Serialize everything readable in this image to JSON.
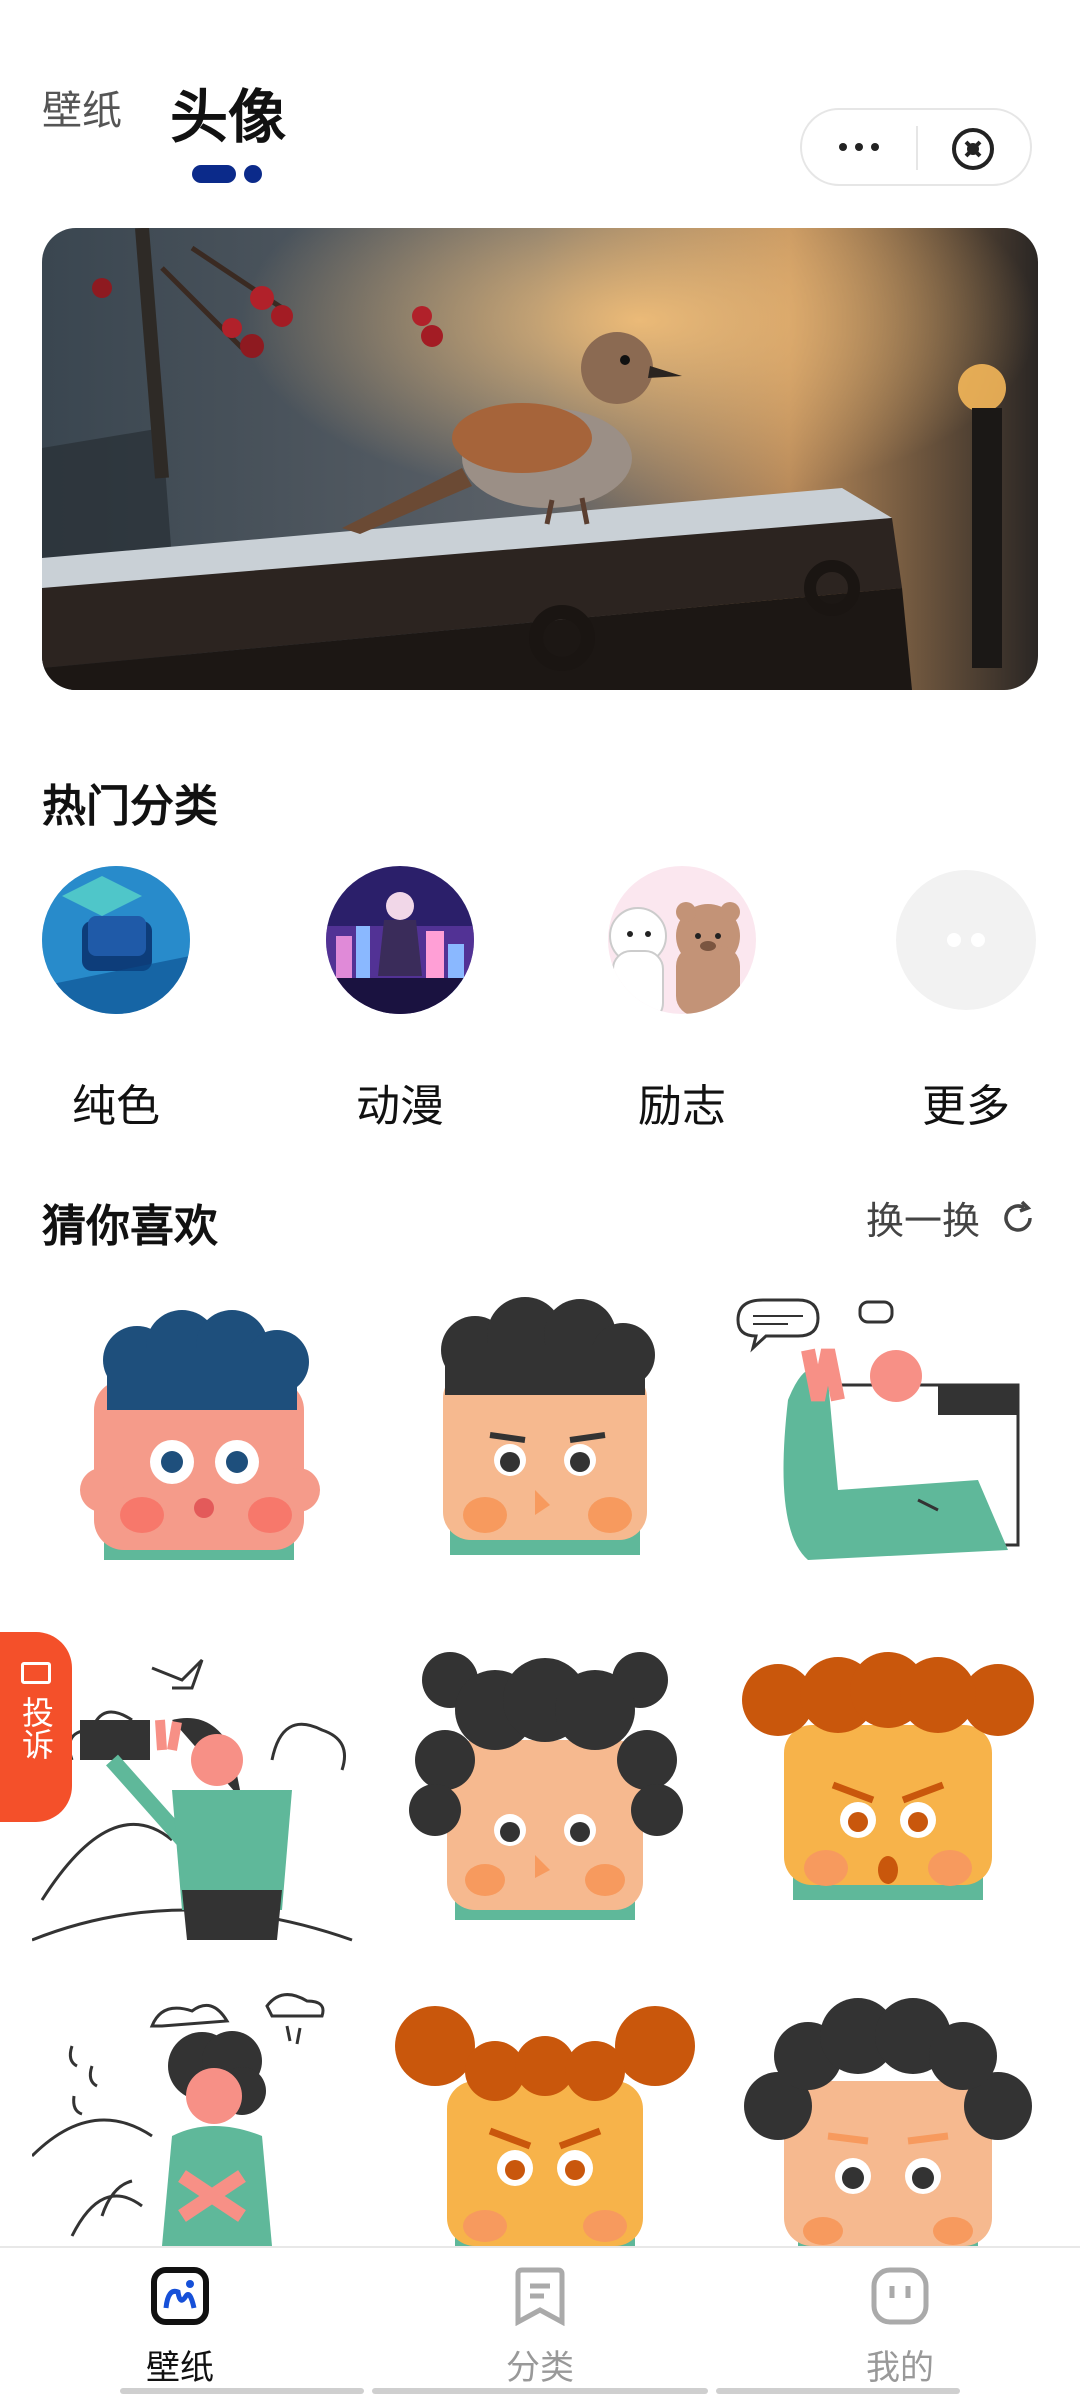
{
  "header": {
    "tabs": [
      "壁纸",
      "头像"
    ],
    "active_tab": "头像"
  },
  "hot": {
    "title": "热门分类",
    "categories": [
      {
        "label": "纯色",
        "icon": "blue-chip-image"
      },
      {
        "label": "动漫",
        "icon": "anime-city-image"
      },
      {
        "label": "励志",
        "icon": "bears-image"
      },
      {
        "label": "更多",
        "icon": "more-dots-icon"
      }
    ]
  },
  "guess": {
    "title": "猜你喜欢",
    "refresh_label": "换一换"
  },
  "complain": {
    "label": "投诉"
  },
  "nav": {
    "items": [
      {
        "label": "壁纸",
        "active": true
      },
      {
        "label": "分类",
        "active": false
      },
      {
        "label": "我的",
        "active": false
      }
    ]
  },
  "colors": {
    "accent": "#0b2a8a",
    "complain": "#f4502a",
    "avatar_green": "#5fb89a",
    "skin": "#f6b98f",
    "hair_blue": "#1e4f7c",
    "hair_dark": "#333333",
    "hair_orange": "#c9570c"
  }
}
